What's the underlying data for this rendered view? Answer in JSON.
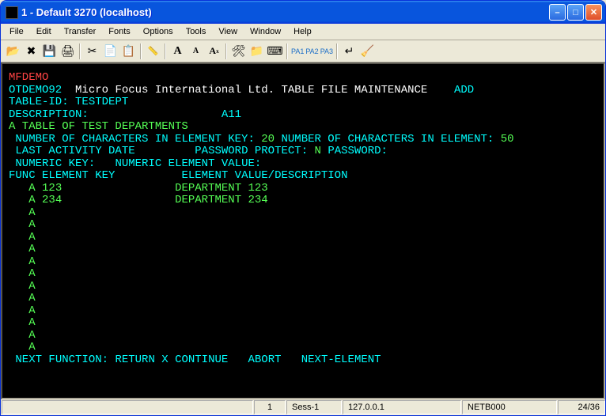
{
  "window": {
    "title": "1 - Default 3270 (localhost)"
  },
  "menu": [
    "File",
    "Edit",
    "Transfer",
    "Fonts",
    "Options",
    "Tools",
    "View",
    "Window",
    "Help"
  ],
  "toolbar": {
    "pa1": "PA1",
    "pa2": "PA2",
    "pa3": "PA3"
  },
  "term": {
    "header": "MFDEMO",
    "prog": "OTDEMO92",
    "company": "Micro Focus International Ltd.",
    "screen": "TABLE FILE MAINTENANCE",
    "mode": "ADD",
    "tableid_lbl": "TABLE-ID:",
    "tableid_val": "TESTDEPT",
    "desc_lbl": "DESCRIPTION:",
    "desc_val": "A11",
    "desc_text": "A TABLE OF TEST DEPARTMENTS",
    "num_key_lbl": "NUMBER OF CHARACTERS IN ELEMENT KEY:",
    "num_key_val": "20",
    "num_elem_lbl": "NUMBER OF CHARACTERS IN ELEMENT:",
    "num_elem_val": "50",
    "last_act": "LAST ACTIVITY DATE",
    "pwd_prot_lbl": "PASSWORD PROTECT:",
    "pwd_prot_val": "N",
    "pwd_lbl": "PASSWORD:",
    "numkey_lbl": "NUMERIC KEY:",
    "numval_lbl": "NUMERIC ELEMENT VALUE:",
    "col_func": "FUNC",
    "col_key": "ELEMENT KEY",
    "col_val": "ELEMENT VALUE/DESCRIPTION",
    "rows": [
      {
        "func": "A",
        "key": "123",
        "val": "DEPARTMENT 123"
      },
      {
        "func": "A",
        "key": "234",
        "val": "DEPARTMENT 234"
      },
      {
        "func": "A",
        "key": "",
        "val": ""
      },
      {
        "func": "A",
        "key": "",
        "val": ""
      },
      {
        "func": "A",
        "key": "",
        "val": ""
      },
      {
        "func": "A",
        "key": "",
        "val": ""
      },
      {
        "func": "A",
        "key": "",
        "val": ""
      },
      {
        "func": "A",
        "key": "",
        "val": ""
      },
      {
        "func": "A",
        "key": "",
        "val": ""
      },
      {
        "func": "A",
        "key": "",
        "val": ""
      },
      {
        "func": "A",
        "key": "",
        "val": ""
      },
      {
        "func": "A",
        "key": "",
        "val": ""
      },
      {
        "func": "A",
        "key": "",
        "val": ""
      },
      {
        "func": "A",
        "key": "",
        "val": ""
      }
    ],
    "next_fn_lbl": "NEXT FUNCTION:",
    "return": "RETURN",
    "xcont": "X CONTINUE",
    "abort": "ABORT",
    "nextelem": "NEXT-ELEMENT"
  },
  "status": {
    "sess_num": "1",
    "sess_name": "Sess-1",
    "host": "127.0.0.1",
    "net": "NETB000",
    "pos": "24/36"
  }
}
